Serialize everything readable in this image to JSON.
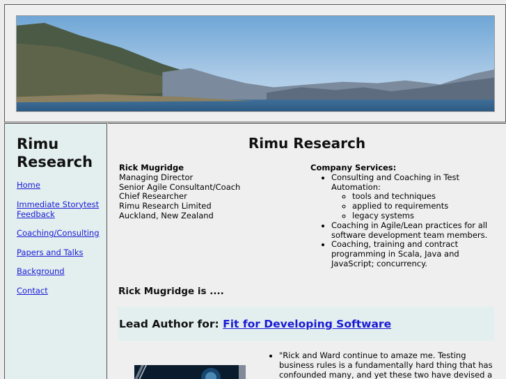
{
  "site": {
    "title_line1": "Rimu",
    "title_line2": "Research"
  },
  "nav": [
    {
      "label": "Home"
    },
    {
      "label": "Immediate Storytest Feedback"
    },
    {
      "label": "Coaching/Consulting"
    },
    {
      "label": "Papers and Talks"
    },
    {
      "label": "Background"
    },
    {
      "label": "Contact"
    }
  ],
  "main": {
    "title": "Rimu Research",
    "contact": {
      "name": "Rick Mugridge",
      "lines": [
        "Managing Director",
        "Senior Agile Consultant/Coach",
        "Chief Researcher",
        "Rimu Research Limited",
        "Auckland, New Zealand"
      ]
    },
    "services": {
      "heading": "Company Services:",
      "items": [
        "Consulting and Coaching in Test Automation:",
        "Coaching in Agile/Lean practices for all software development team members.",
        "Coaching, training and contract programming in Scala, Java and JavaScript; concurrency."
      ],
      "sub_items": [
        "tools and techniques",
        "applied to requirements",
        "legacy systems"
      ]
    },
    "intro": "Rick Mugridge is ....",
    "lead_prefix": "Lead Author for:",
    "lead_link": "Fit for Developing Software",
    "quote": "\"Rick and Ward continue to amaze me. Testing business rules is a fundamentally hard thing that has confounded many, and yet these two have devised a mechanism that"
  },
  "colors": {
    "link": "#1a1ad6",
    "sidebar_bg": "#e2efee",
    "page_bg": "#efefef"
  }
}
